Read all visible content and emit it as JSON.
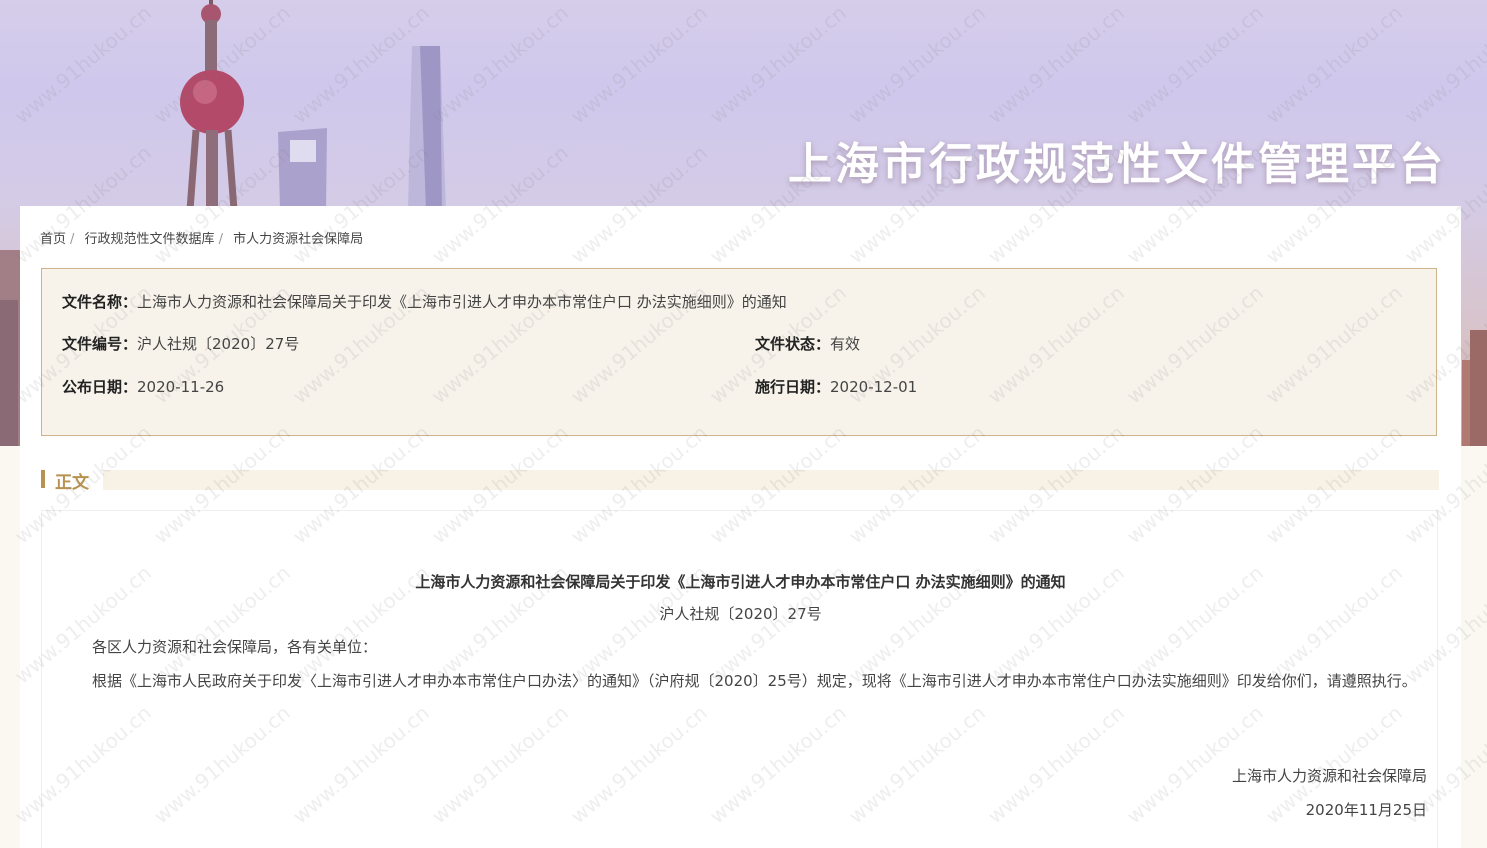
{
  "banner": {
    "title": "上海市行政规范性文件管理平台"
  },
  "breadcrumb": [
    {
      "label": "首页"
    },
    {
      "label": "行政规范性文件数据库"
    },
    {
      "label": "市人力资源社会保障局"
    }
  ],
  "meta": {
    "name_key": "文件名称：",
    "name_value": "上海市人力资源和社会保障局关于印发《上海市引进人才申办本市常住户口 办法实施细则》的通知",
    "number_key": "文件编号：",
    "number_value": "沪人社规〔2020〕27号",
    "status_key": "文件状态：",
    "status_value": "有效",
    "publish_key": "公布日期：",
    "publish_value": "2020-11-26",
    "effective_key": "施行日期：",
    "effective_value": "2020-12-01"
  },
  "section": {
    "title": "正文"
  },
  "document": {
    "title": "上海市人力资源和社会保障局关于印发《上海市引进人才申办本市常住户口 办法实施细则》的通知",
    "number": "沪人社规〔2020〕27号",
    "salutation": "各区人力资源和社会保障局，各有关单位：",
    "body": "根据《上海市人民政府关于印发〈上海市引进人才申办本市常住户口办法〉的通知》（沪府规〔2020〕25号）规定，现将《上海市引进人才申办本市常住户口办法实施细则》印发给你们，请遵照执行。",
    "issuer": "上海市人力资源和社会保障局",
    "date": "2020年11月25日"
  },
  "watermark": {
    "text": "www.91hukou.cn"
  },
  "colors": {
    "accent": "#b8924f",
    "meta_bg": "#f7f2ea",
    "meta_border": "#cdb48a"
  }
}
